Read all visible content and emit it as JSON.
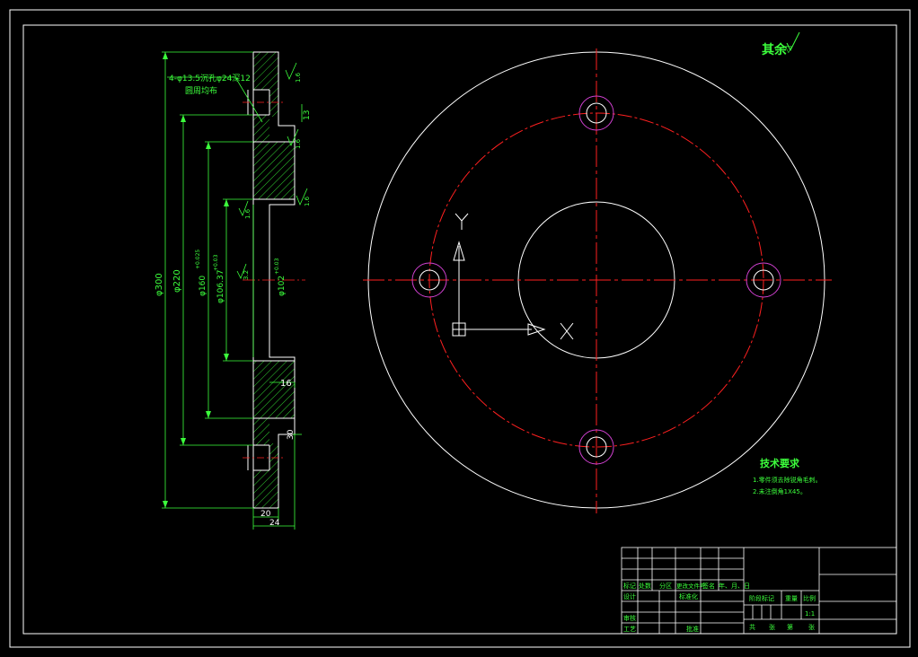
{
  "colors": {
    "background": "#000000",
    "outline": "#ffffff",
    "centerline": "#ff2020",
    "annotation": "#3cff3c",
    "hatch": "#3cff3c",
    "hole_circle": "#d040d0"
  },
  "section_view": {
    "hole_note_line1": "4-φ13.5沉孔φ24深12",
    "hole_note_line2": "圆周均布",
    "roughness_top": "1.6",
    "roughness_bore": "1.6",
    "roughness_face": "1.6",
    "roughness_step": "1.6",
    "roughness_inner": "3.2",
    "dim_13": "13",
    "dim_phi300": "φ300",
    "dim_phi220": "φ220",
    "dim_phi160": "φ160",
    "dim_phi160_tol": "+0.025",
    "dim_phi106": "φ106.37",
    "dim_phi106_tol": "+0.03",
    "dim_phi102": "φ102",
    "dim_phi102_tol": "+0.03",
    "dim_16": "16",
    "dim_30": "30",
    "dim_20": "20",
    "dim_24": "24"
  },
  "plan_view": {
    "axis_y": "Y",
    "axis_x": "X"
  },
  "notes": {
    "roughness_rest": "其余",
    "roughness_rest_symbol": "▽",
    "tech_title": "技术要求",
    "tech_line1": "1.零件须去除锐角毛刺。",
    "tech_line2": "2.未注倒角1X45。"
  },
  "title_block": {
    "mark": "标记",
    "count": "处数",
    "zone": "分区",
    "change_doc": "更改文件号",
    "signature": "签名",
    "date": "年、月、日",
    "design": "设计",
    "standardize": "标准化",
    "stage_mark": "阶段标记",
    "weight": "重量",
    "scale": "比例",
    "scale_value": "1:1",
    "review": "审核",
    "process": "工艺",
    "approve": "批准",
    "sheets_total": "共",
    "sheets_unit": "张",
    "sheet_no": "第",
    "sheet_unit": "张"
  }
}
